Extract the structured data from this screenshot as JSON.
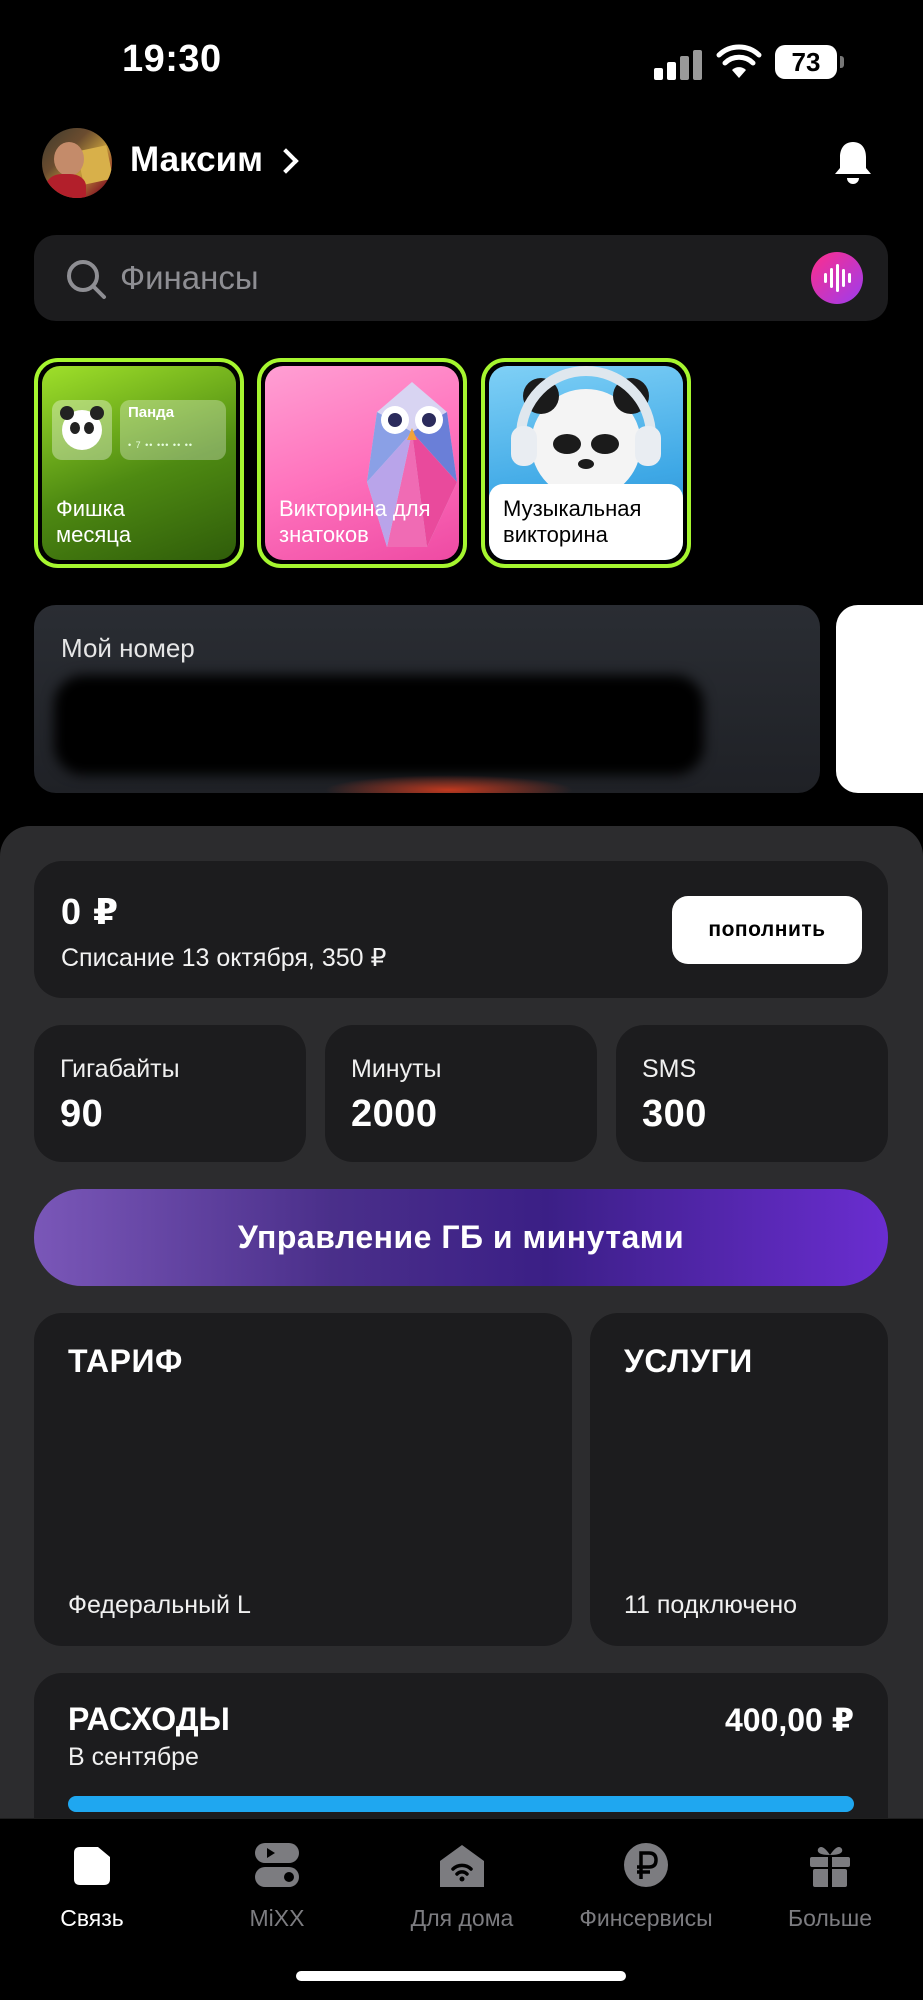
{
  "status_bar": {
    "time": "19:30",
    "battery": "73"
  },
  "header": {
    "user_name": "Максим"
  },
  "search": {
    "placeholder": "Финансы"
  },
  "stories": [
    {
      "label": "Фишка месяца",
      "card_title": "Панда",
      "card_number": "• 7 •• ••• •• ••"
    },
    {
      "label": "Викторина для знатоков"
    },
    {
      "label": "Музыкальная викторина"
    }
  ],
  "number_card": {
    "title": "Мой номер"
  },
  "balance": {
    "amount": "0 ₽",
    "next_charge": "Списание 13 октября, 350 ₽",
    "topup_label": "пополнить"
  },
  "stats": [
    {
      "label": "Гигабайты",
      "value": "90"
    },
    {
      "label": "Минуты",
      "value": "2000"
    },
    {
      "label": "SMS",
      "value": "300"
    }
  ],
  "manage_label": "Управление ГБ и минутами",
  "tariff": {
    "title": "ТАРИФ",
    "name": "Федеральный L"
  },
  "services": {
    "title": "УСЛУГИ",
    "summary": "11 подключено"
  },
  "expenses": {
    "title": "РАСХОДЫ",
    "period": "В сентябре",
    "amount": "400,00 ₽"
  },
  "tabs": [
    {
      "label": "Связь",
      "icon": "sim-card-icon",
      "active": true
    },
    {
      "label": "MiXX",
      "icon": "mixx-icon",
      "active": false
    },
    {
      "label": "Для дома",
      "icon": "home-wifi-icon",
      "active": false
    },
    {
      "label": "Финсервисы",
      "icon": "ruble-icon",
      "active": false
    },
    {
      "label": "Больше",
      "icon": "gift-icon",
      "active": false
    }
  ],
  "colors": {
    "accent_green": "#a6f62f",
    "manage_gradient": "#3b1f86",
    "expense_bar": "#1fa7f0",
    "voice_gradient": "#ff2d8a"
  }
}
